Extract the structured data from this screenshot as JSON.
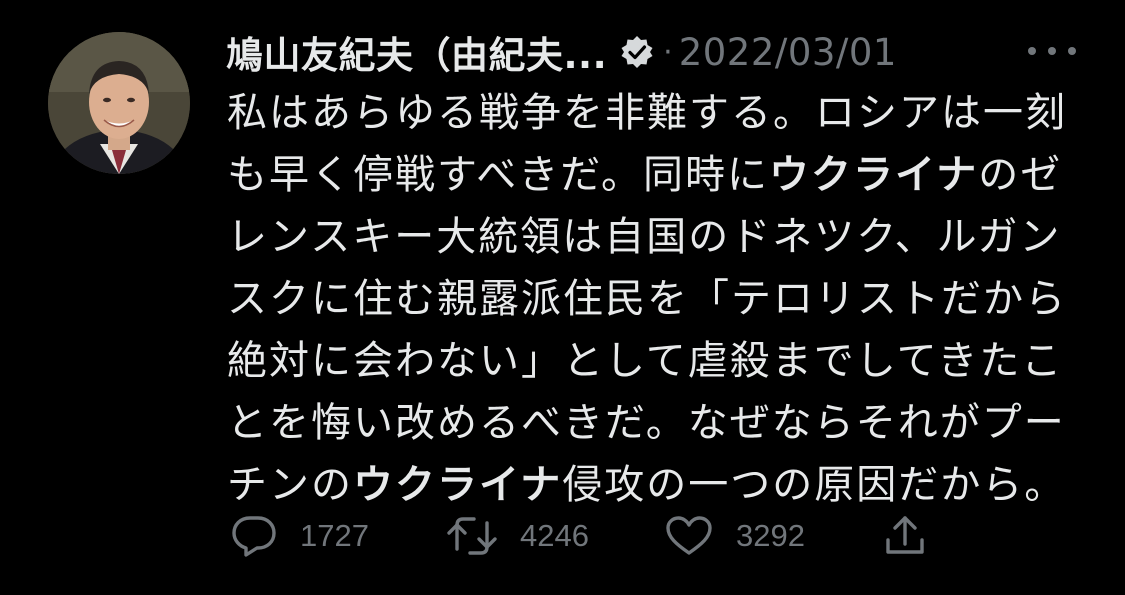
{
  "tweet": {
    "author_name": "鳩山友紀夫（由紀夫...",
    "separator": "·",
    "date": "2022/03/01",
    "lines": [
      [
        {
          "t": "私はあらゆる戦争を非難する。ロシアは一刻",
          "b": false
        }
      ],
      [
        {
          "t": "も早く停戦すべきだ。同時に",
          "b": false
        },
        {
          "t": "ウクライナ",
          "b": true
        },
        {
          "t": "のゼ",
          "b": false
        }
      ],
      [
        {
          "t": "レンスキー大統領は自国のドネツク、ルガン",
          "b": false
        }
      ],
      [
        {
          "t": "スクに住む親露派住民を「テロリストだから",
          "b": false
        }
      ],
      [
        {
          "t": "絶対に会わない」として虐殺までしてきたこ",
          "b": false
        }
      ],
      [
        {
          "t": "とを悔い改めるべきだ。なぜならそれがプー",
          "b": false
        }
      ],
      [
        {
          "t": "チンの",
          "b": false
        },
        {
          "t": "ウクライナ",
          "b": true
        },
        {
          "t": "侵攻の一つの原因だから。",
          "b": false
        }
      ]
    ]
  },
  "actions": {
    "replies": "1727",
    "retweets": "4246",
    "likes": "3292"
  },
  "icons": {
    "verified": "verified-badge-icon",
    "more": "more-options-icon",
    "reply": "reply-icon",
    "retweet": "retweet-icon",
    "like": "heart-icon",
    "share": "share-icon"
  },
  "colors": {
    "background": "#000000",
    "text": "#e7e9ea",
    "secondary": "#71767b",
    "verified_badge": "#d6d9db"
  }
}
